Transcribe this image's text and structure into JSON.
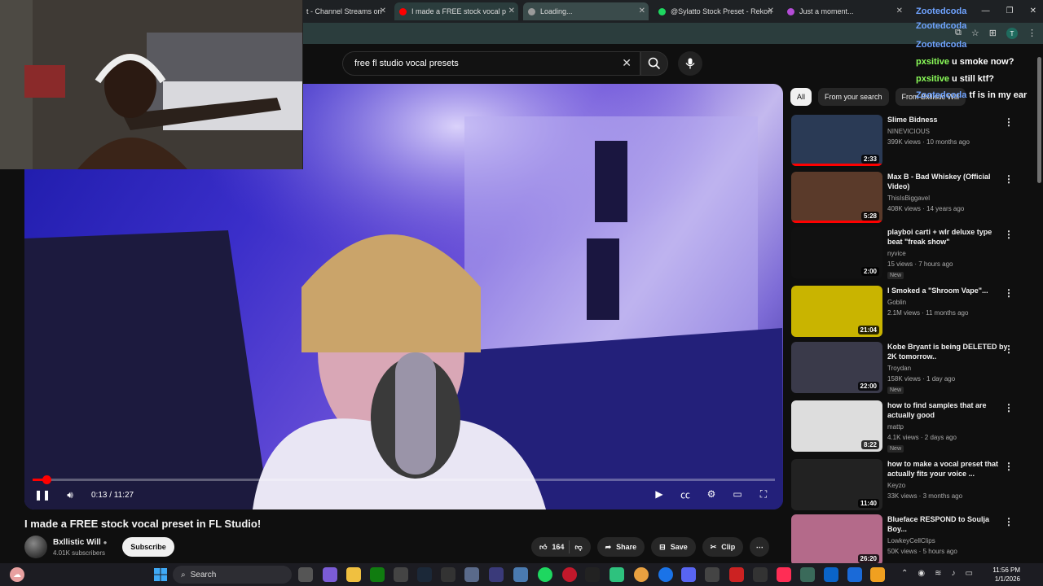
{
  "browser": {
    "tabs": [
      {
        "label": "t - Channel Streams on",
        "color": "#7a7a7a"
      },
      {
        "label": "I made a FREE stock vocal p",
        "color": "#ff0000",
        "active": true
      },
      {
        "label": "Loading...",
        "color": "#9a9a9a"
      },
      {
        "label": "@Sylatto Stock Preset - Rekon",
        "color": "#1ed760"
      },
      {
        "label": "Just a moment...",
        "color": "#b44cd6"
      }
    ],
    "avatar_letter": "T"
  },
  "search": {
    "query": "free fl studio vocal presets"
  },
  "player": {
    "current_time": "0:13",
    "duration": "11:27",
    "time_display": "0:13 / 11:27",
    "progress": 0.019
  },
  "video": {
    "title": "I made a FREE stock vocal preset in FL Studio!",
    "channel": "Bxllistic Will",
    "verified": true,
    "subscribers": "4.01K subscribers",
    "subscribe_label": "Subscribe",
    "likes": "164",
    "share_label": "Share",
    "save_label": "Save",
    "clip_label": "Clip"
  },
  "filters": [
    "All",
    "From your search",
    "From Bxllistic Will"
  ],
  "recommendations": [
    {
      "title": "Slime Bidness",
      "channel": "NINEVICIOUS",
      "meta": "399K views · 10 months ago",
      "duration": "2:33",
      "watched": 1.0,
      "thumb": "#2a3a55",
      "music": true
    },
    {
      "title": "Max B - Bad Whiskey (Official Video)",
      "channel": "ThisIsBiggavel",
      "meta": "408K views · 14 years ago",
      "duration": "5:28",
      "watched": 1.0,
      "thumb": "#5a3a2a",
      "music": true
    },
    {
      "title": "playboi carti + wlr deluxe type beat \"freak show\"",
      "channel": "nyvice",
      "meta": "15 views · 7 hours ago",
      "duration": "2:00",
      "badge": "New",
      "thumb": "#111111"
    },
    {
      "title": "I Smoked a \"Shroom Vape\"...",
      "channel": "Goblin",
      "verified": true,
      "meta": "2.1M views · 11 months ago",
      "duration": "21:04",
      "thumb": "#c9b400"
    },
    {
      "title": "Kobe Bryant is being DELETED by 2K tomorrow..",
      "channel": "Troydan",
      "verified": true,
      "meta": "158K views · 1 day ago",
      "duration": "22:00",
      "badge": "New",
      "thumb": "#3a3a4a"
    },
    {
      "title": "how to find samples that are actually good",
      "channel": "mattp",
      "meta": "4.1K views · 2 days ago",
      "duration": "8:22",
      "badge": "New",
      "thumb": "#dddddd"
    },
    {
      "title": "how to make a vocal preset that actually fits your voice ...",
      "channel": "Keyzo",
      "meta": "33K views · 3 months ago",
      "duration": "11:40",
      "thumb": "#222222"
    },
    {
      "title": "Blueface RESPOND to Soulja Boy...",
      "channel": "LowkeyCellClips",
      "meta": "50K views · 5 hours ago",
      "duration": "26:20",
      "thumb": "#b46a8a"
    }
  ],
  "chat": [
    {
      "user": "Zootedcoda",
      "text": "",
      "color": "#6fa3ff"
    },
    {
      "user": "Zootedcoda",
      "text": "",
      "color": "#6fa3ff"
    },
    {
      "user": "Zootedcoda",
      "text": "",
      "color": "#6fa3ff"
    },
    {
      "user": "pxsitive",
      "text": "u smoke now?",
      "color": "#8cff5a"
    },
    {
      "user": "pxsitive",
      "text": "u still ktf?",
      "color": "#8cff5a"
    },
    {
      "user": "Zootedcoda",
      "text": "tf is in my ear",
      "color": "#6fa3ff"
    }
  ],
  "taskbar": {
    "search_label": "Search",
    "time": "11:56 PM",
    "date": "1/1/2026"
  }
}
